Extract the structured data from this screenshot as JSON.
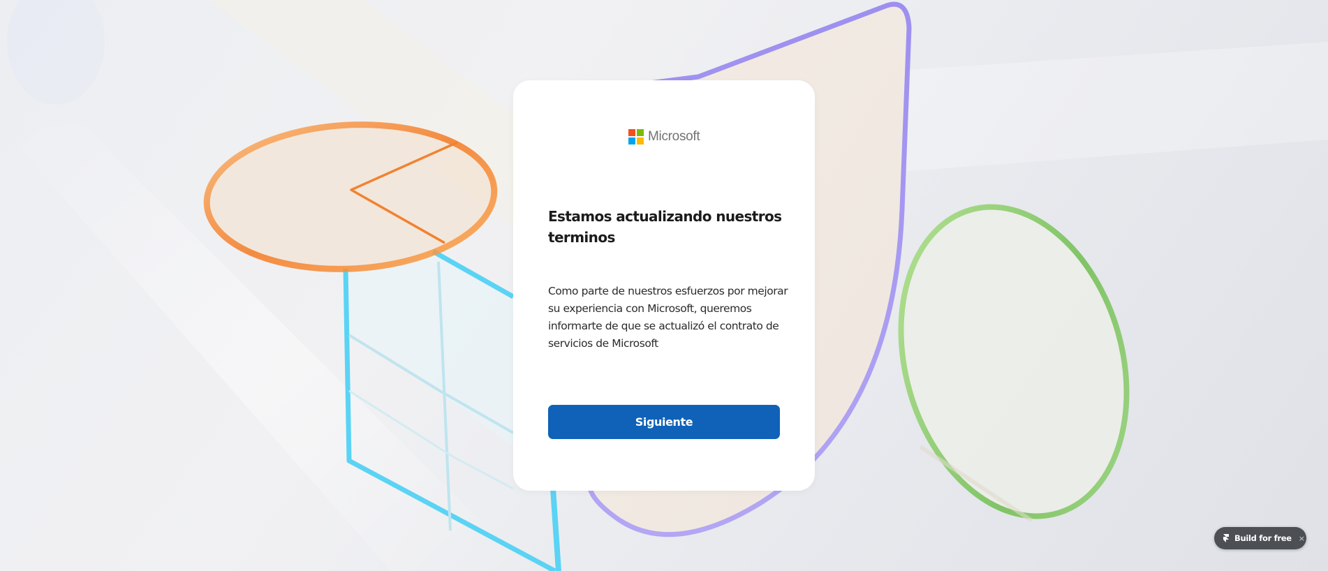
{
  "brand": {
    "name": "Microsoft",
    "logo_colors": [
      "#f25022",
      "#7fba00",
      "#00a4ef",
      "#ffb900"
    ]
  },
  "dialog": {
    "title": "Estamos actualizando nuestros terminos",
    "body": "Como parte de nuestros esfuerzos por mejorar su experiencia con Microsoft, queremos informarte de que se actualizó el contrato de servicios de Microsoft",
    "next_button_label": "Siguiente"
  },
  "badge": {
    "label": "Build for free",
    "close_symbol": "×",
    "icon": "framer-icon"
  },
  "colors": {
    "primary_button": "#0f62b7",
    "orange_ring": "#f7892a",
    "cyan_glass": "#5fd6f5",
    "purple_shape": "#a99cf0",
    "green_ring": "#7ccb4c"
  }
}
